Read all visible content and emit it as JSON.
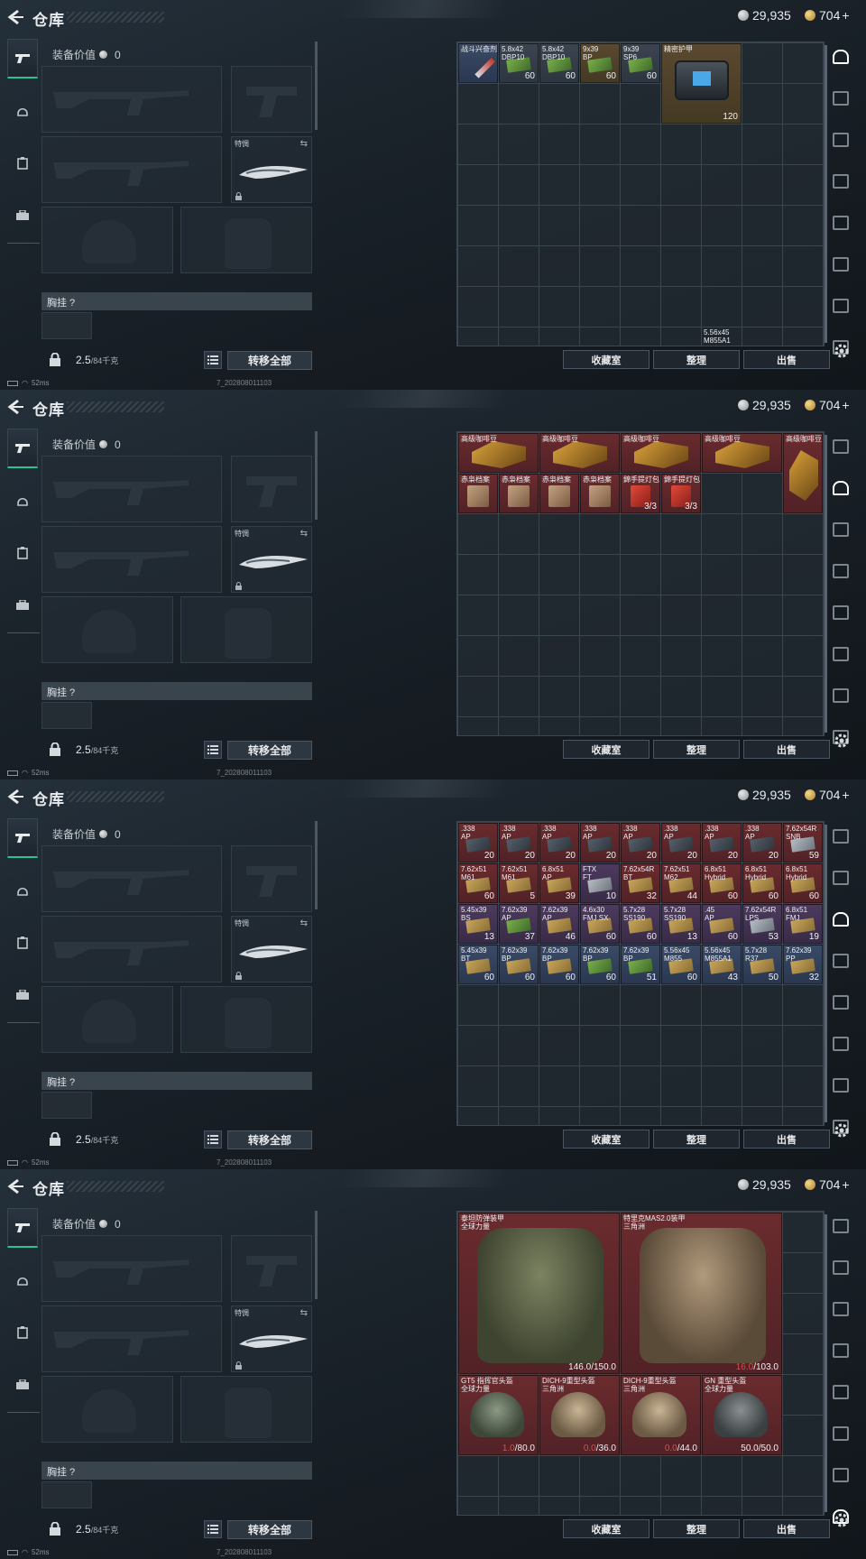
{
  "header": {
    "title": "仓库",
    "silver": "29,935",
    "gold": "704",
    "gold_plus": "+"
  },
  "loadout": {
    "equip_value_label": "装备价值",
    "equip_value": "0",
    "melee_label": "特惆",
    "chest_label": "胸挂 ?",
    "weight": "2.5",
    "weight_cap": "/84千克",
    "transfer_all": "转移全部"
  },
  "status": {
    "ping": "52ms",
    "build": "7_202808011103"
  },
  "actions": {
    "collection": "收藏室",
    "sort": "整理",
    "sell": "出售"
  },
  "icons": [
    "back-icon",
    "pistol-icon",
    "helmet-icon",
    "vest-icon",
    "briefcase-icon",
    "silver-coin-icon",
    "gold-coin-icon",
    "lock-icon",
    "list-icon",
    "gear-icon",
    "swap-icon"
  ],
  "screens": [
    {
      "items": [
        {
          "name": "战斗兴奋剂",
          "count": "",
          "color": "blue",
          "c": 0,
          "r": 0,
          "w": 1,
          "h": 1,
          "kind": "syringe"
        },
        {
          "name": "5.8x42\nDBP10",
          "count": "60",
          "color": "grey",
          "c": 1,
          "r": 0,
          "w": 1,
          "h": 1,
          "kind": "ammo-green"
        },
        {
          "name": "5.8x42\nDBP10",
          "count": "60",
          "color": "grey",
          "c": 2,
          "r": 0,
          "w": 1,
          "h": 1,
          "kind": "ammo-green"
        },
        {
          "name": "9x39\nBP",
          "count": "60",
          "color": "brown",
          "c": 3,
          "r": 0,
          "w": 1,
          "h": 1,
          "kind": "ammo-green"
        },
        {
          "name": "9x39\nSP6",
          "count": "60",
          "color": "grey",
          "c": 4,
          "r": 0,
          "w": 1,
          "h": 1,
          "kind": "ammo-green"
        },
        {
          "name": "精密护甲",
          "count": "120",
          "color": "brown",
          "c": 5,
          "r": 0,
          "w": 2,
          "h": 2,
          "kind": "bag"
        },
        {
          "name": "5.56x45\nM855A1",
          "count": "",
          "color": "none",
          "c": 6,
          "r": 7,
          "w": 1,
          "h": 1,
          "kind": "none"
        }
      ]
    },
    {
      "items": [
        {
          "name": "高级咖啡豆",
          "count": "",
          "color": "red",
          "c": 0,
          "r": 0,
          "w": 2,
          "h": 1,
          "kind": "coffee"
        },
        {
          "name": "高级咖啡豆",
          "count": "",
          "color": "red",
          "c": 2,
          "r": 0,
          "w": 2,
          "h": 1,
          "kind": "coffee"
        },
        {
          "name": "高级咖啡豆",
          "count": "",
          "color": "red",
          "c": 4,
          "r": 0,
          "w": 2,
          "h": 1,
          "kind": "coffee"
        },
        {
          "name": "高级咖啡豆",
          "count": "",
          "color": "red",
          "c": 6,
          "r": 0,
          "w": 2,
          "h": 1,
          "kind": "coffee"
        },
        {
          "name": "高级咖啡豆",
          "count": "",
          "color": "red",
          "c": 8,
          "r": 0,
          "w": 1,
          "h": 2,
          "kind": "coffee-bag"
        },
        {
          "name": "赤枭档案",
          "count": "",
          "color": "red",
          "c": 0,
          "r": 1,
          "w": 1,
          "h": 1,
          "kind": "file"
        },
        {
          "name": "赤枭档案",
          "count": "",
          "color": "red",
          "c": 1,
          "r": 1,
          "w": 1,
          "h": 1,
          "kind": "file"
        },
        {
          "name": "赤枭档案",
          "count": "",
          "color": "red",
          "c": 2,
          "r": 1,
          "w": 1,
          "h": 1,
          "kind": "file"
        },
        {
          "name": "赤枭档案",
          "count": "",
          "color": "red",
          "c": 3,
          "r": 1,
          "w": 1,
          "h": 1,
          "kind": "file"
        },
        {
          "name": "錦手提灯包",
          "count": "3/3",
          "color": "red",
          "c": 4,
          "r": 1,
          "w": 1,
          "h": 1,
          "kind": "redpack"
        },
        {
          "name": "錦手提灯包",
          "count": "3/3",
          "color": "red",
          "c": 5,
          "r": 1,
          "w": 1,
          "h": 1,
          "kind": "redpack"
        }
      ]
    },
    {
      "items": [
        {
          "name": ".338\nAP",
          "count": "20",
          "color": "red",
          "c": 0,
          "r": 0,
          "w": 1,
          "h": 1,
          "kind": "ammo-dark"
        },
        {
          "name": ".338\nAP",
          "count": "20",
          "color": "red",
          "c": 1,
          "r": 0,
          "w": 1,
          "h": 1,
          "kind": "ammo-dark"
        },
        {
          "name": ".338\nAP",
          "count": "20",
          "color": "red",
          "c": 2,
          "r": 0,
          "w": 1,
          "h": 1,
          "kind": "ammo-dark"
        },
        {
          "name": ".338\nAP",
          "count": "20",
          "color": "red",
          "c": 3,
          "r": 0,
          "w": 1,
          "h": 1,
          "kind": "ammo-dark"
        },
        {
          "name": ".338\nAP",
          "count": "20",
          "color": "red",
          "c": 4,
          "r": 0,
          "w": 1,
          "h": 1,
          "kind": "ammo-dark"
        },
        {
          "name": ".338\nAP",
          "count": "20",
          "color": "red",
          "c": 5,
          "r": 0,
          "w": 1,
          "h": 1,
          "kind": "ammo-dark"
        },
        {
          "name": ".338\nAP",
          "count": "20",
          "color": "red",
          "c": 6,
          "r": 0,
          "w": 1,
          "h": 1,
          "kind": "ammo-dark"
        },
        {
          "name": ".338\nAP",
          "count": "20",
          "color": "red",
          "c": 7,
          "r": 0,
          "w": 1,
          "h": 1,
          "kind": "ammo-dark"
        },
        {
          "name": "7.62x54R\nSNB",
          "count": "59",
          "color": "red",
          "c": 8,
          "r": 0,
          "w": 1,
          "h": 1,
          "kind": "ammo-grey"
        },
        {
          "name": "7.62x51\nM61",
          "count": "60",
          "color": "red",
          "c": 0,
          "r": 1,
          "w": 1,
          "h": 1,
          "kind": "ammo"
        },
        {
          "name": "7.62x51\nM61",
          "count": "5",
          "color": "red",
          "c": 1,
          "r": 1,
          "w": 1,
          "h": 1,
          "kind": "ammo"
        },
        {
          "name": "6.8x51\nAP",
          "count": "39",
          "color": "red",
          "c": 2,
          "r": 1,
          "w": 1,
          "h": 1,
          "kind": "ammo"
        },
        {
          "name": "FTX\nFT",
          "count": "10",
          "color": "purple",
          "c": 3,
          "r": 1,
          "w": 1,
          "h": 1,
          "kind": "ammo-grey"
        },
        {
          "name": "7.62x54R\nBT",
          "count": "32",
          "color": "red",
          "c": 4,
          "r": 1,
          "w": 1,
          "h": 1,
          "kind": "ammo"
        },
        {
          "name": "7.62x51\nM62",
          "count": "44",
          "color": "red",
          "c": 5,
          "r": 1,
          "w": 1,
          "h": 1,
          "kind": "ammo"
        },
        {
          "name": "6.8x51\nHybrid",
          "count": "60",
          "color": "red",
          "c": 6,
          "r": 1,
          "w": 1,
          "h": 1,
          "kind": "ammo"
        },
        {
          "name": "6.8x51\nHybrid",
          "count": "60",
          "color": "red",
          "c": 7,
          "r": 1,
          "w": 1,
          "h": 1,
          "kind": "ammo"
        },
        {
          "name": "6.8x51\nHybrid",
          "count": "60",
          "color": "red",
          "c": 8,
          "r": 1,
          "w": 1,
          "h": 1,
          "kind": "ammo"
        },
        {
          "name": "5.45x39\nBS",
          "count": "13",
          "color": "purple",
          "c": 0,
          "r": 2,
          "w": 1,
          "h": 1,
          "kind": "ammo"
        },
        {
          "name": "7.62x39\nAP",
          "count": "37",
          "color": "purple",
          "c": 1,
          "r": 2,
          "w": 1,
          "h": 1,
          "kind": "ammo-green"
        },
        {
          "name": "7.62x39\nAP",
          "count": "46",
          "color": "purple",
          "c": 2,
          "r": 2,
          "w": 1,
          "h": 1,
          "kind": "ammo"
        },
        {
          "name": "4.6x30\nFMJ SX",
          "count": "60",
          "color": "purple",
          "c": 3,
          "r": 2,
          "w": 1,
          "h": 1,
          "kind": "ammo"
        },
        {
          "name": "5.7x28\nSS190",
          "count": "60",
          "color": "purple",
          "c": 4,
          "r": 2,
          "w": 1,
          "h": 1,
          "kind": "ammo"
        },
        {
          "name": "5.7x28\nSS190",
          "count": "13",
          "color": "purple",
          "c": 5,
          "r": 2,
          "w": 1,
          "h": 1,
          "kind": "ammo"
        },
        {
          "name": ".45\nAP",
          "count": "60",
          "color": "purple",
          "c": 6,
          "r": 2,
          "w": 1,
          "h": 1,
          "kind": "ammo"
        },
        {
          "name": "7.62x54R\nLPS",
          "count": "53",
          "color": "purple",
          "c": 7,
          "r": 2,
          "w": 1,
          "h": 1,
          "kind": "ammo-grey"
        },
        {
          "name": "6.8x51\nFMJ",
          "count": "19",
          "color": "purple",
          "c": 8,
          "r": 2,
          "w": 1,
          "h": 1,
          "kind": "ammo"
        },
        {
          "name": "5.45x39\nBT",
          "count": "60",
          "color": "blue",
          "c": 0,
          "r": 3,
          "w": 1,
          "h": 1,
          "kind": "ammo"
        },
        {
          "name": "7.62x39\nBP",
          "count": "60",
          "color": "blue",
          "c": 1,
          "r": 3,
          "w": 1,
          "h": 1,
          "kind": "ammo"
        },
        {
          "name": "7.62x39\nBP",
          "count": "60",
          "color": "blue",
          "c": 2,
          "r": 3,
          "w": 1,
          "h": 1,
          "kind": "ammo"
        },
        {
          "name": "7.62x39\nBP",
          "count": "60",
          "color": "blue",
          "c": 3,
          "r": 3,
          "w": 1,
          "h": 1,
          "kind": "ammo-green"
        },
        {
          "name": "7.62x39\nBP",
          "count": "51",
          "color": "blue",
          "c": 4,
          "r": 3,
          "w": 1,
          "h": 1,
          "kind": "ammo-green"
        },
        {
          "name": "5.56x45\nM855",
          "count": "60",
          "color": "blue",
          "c": 5,
          "r": 3,
          "w": 1,
          "h": 1,
          "kind": "ammo"
        },
        {
          "name": "5.56x45\nM855A1",
          "count": "43",
          "color": "blue",
          "c": 6,
          "r": 3,
          "w": 1,
          "h": 1,
          "kind": "ammo"
        },
        {
          "name": "5.7x28\nR37",
          "count": "50",
          "color": "blue",
          "c": 7,
          "r": 3,
          "w": 1,
          "h": 1,
          "kind": "ammo"
        },
        {
          "name": "7.62x39\nPP",
          "count": "32",
          "color": "blue",
          "c": 8,
          "r": 3,
          "w": 1,
          "h": 1,
          "kind": "ammo"
        }
      ]
    },
    {
      "items": [
        {
          "name": "泰坦防弹装甲\n全球力量",
          "count_cur": "146.0",
          "count_max": "/150.0",
          "damaged": false,
          "color": "red",
          "c": 0,
          "r": 0,
          "w": 4,
          "h": 4,
          "kind": "armor-olive"
        },
        {
          "name": "特里克MAS2.0装甲\n三角洲",
          "count_cur": "16.0",
          "count_max": "/103.0",
          "damaged": true,
          "color": "red",
          "c": 4,
          "r": 0,
          "w": 4,
          "h": 4,
          "kind": "armor-camo"
        },
        {
          "name": "GT5 指挥官头盔\n全球力量",
          "count_cur": "1.0",
          "count_max": "/80.0",
          "damaged": true,
          "color": "red",
          "c": 0,
          "r": 4,
          "w": 2,
          "h": 2,
          "kind": "helmet-green"
        },
        {
          "name": "DICH-9重型头盔\n三角洲",
          "count_cur": "0.0",
          "count_max": "/36.0",
          "damaged": true,
          "color": "red",
          "c": 2,
          "r": 4,
          "w": 2,
          "h": 2,
          "kind": "helmet"
        },
        {
          "name": "DICH-9重型头盔\n三角洲",
          "count_cur": "0.0",
          "count_max": "/44.0",
          "damaged": true,
          "color": "red",
          "c": 4,
          "r": 4,
          "w": 2,
          "h": 2,
          "kind": "helmet"
        },
        {
          "name": "GN 重型头盔\n全球力量",
          "count_cur": "50.0",
          "count_max": "/50.0",
          "damaged": false,
          "color": "red",
          "c": 6,
          "r": 4,
          "w": 2,
          "h": 2,
          "kind": "helmet-dark"
        }
      ]
    }
  ]
}
